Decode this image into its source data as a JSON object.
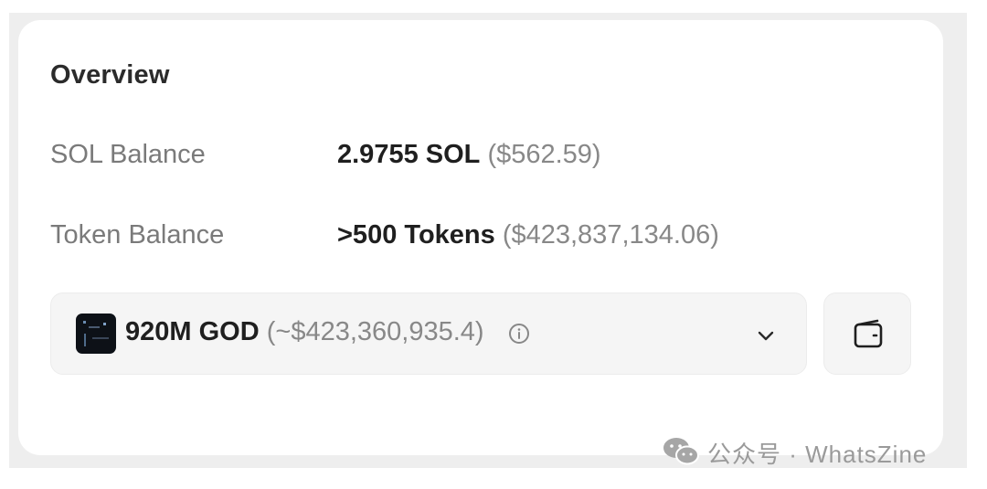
{
  "overview": {
    "title": "Overview",
    "sol_balance": {
      "label": "SOL Balance",
      "amount": "2.9755 SOL",
      "usd": "($562.59)"
    },
    "token_balance": {
      "label": "Token Balance",
      "amount": ">500 Tokens",
      "usd": "($423,837,134.06)"
    },
    "selected_token": {
      "amount": "920M GOD",
      "usd": "(~$423,360,935.4)",
      "logo_icon": "god-token-logo",
      "info_icon": "info-circle-icon",
      "dropdown_icon": "chevron-down-icon"
    },
    "wallet_button": {
      "icon": "wallet-icon"
    }
  },
  "watermark": {
    "text": "公众号 · WhatsZine",
    "icon": "wechat-icon"
  },
  "colors": {
    "primary_text": "#1f1f1f",
    "muted_text": "#888888",
    "label_text": "#7a7a7a",
    "control_bg": "#f5f5f5",
    "card_bg": "#ffffff",
    "frame_bg": "#eeeeee"
  }
}
